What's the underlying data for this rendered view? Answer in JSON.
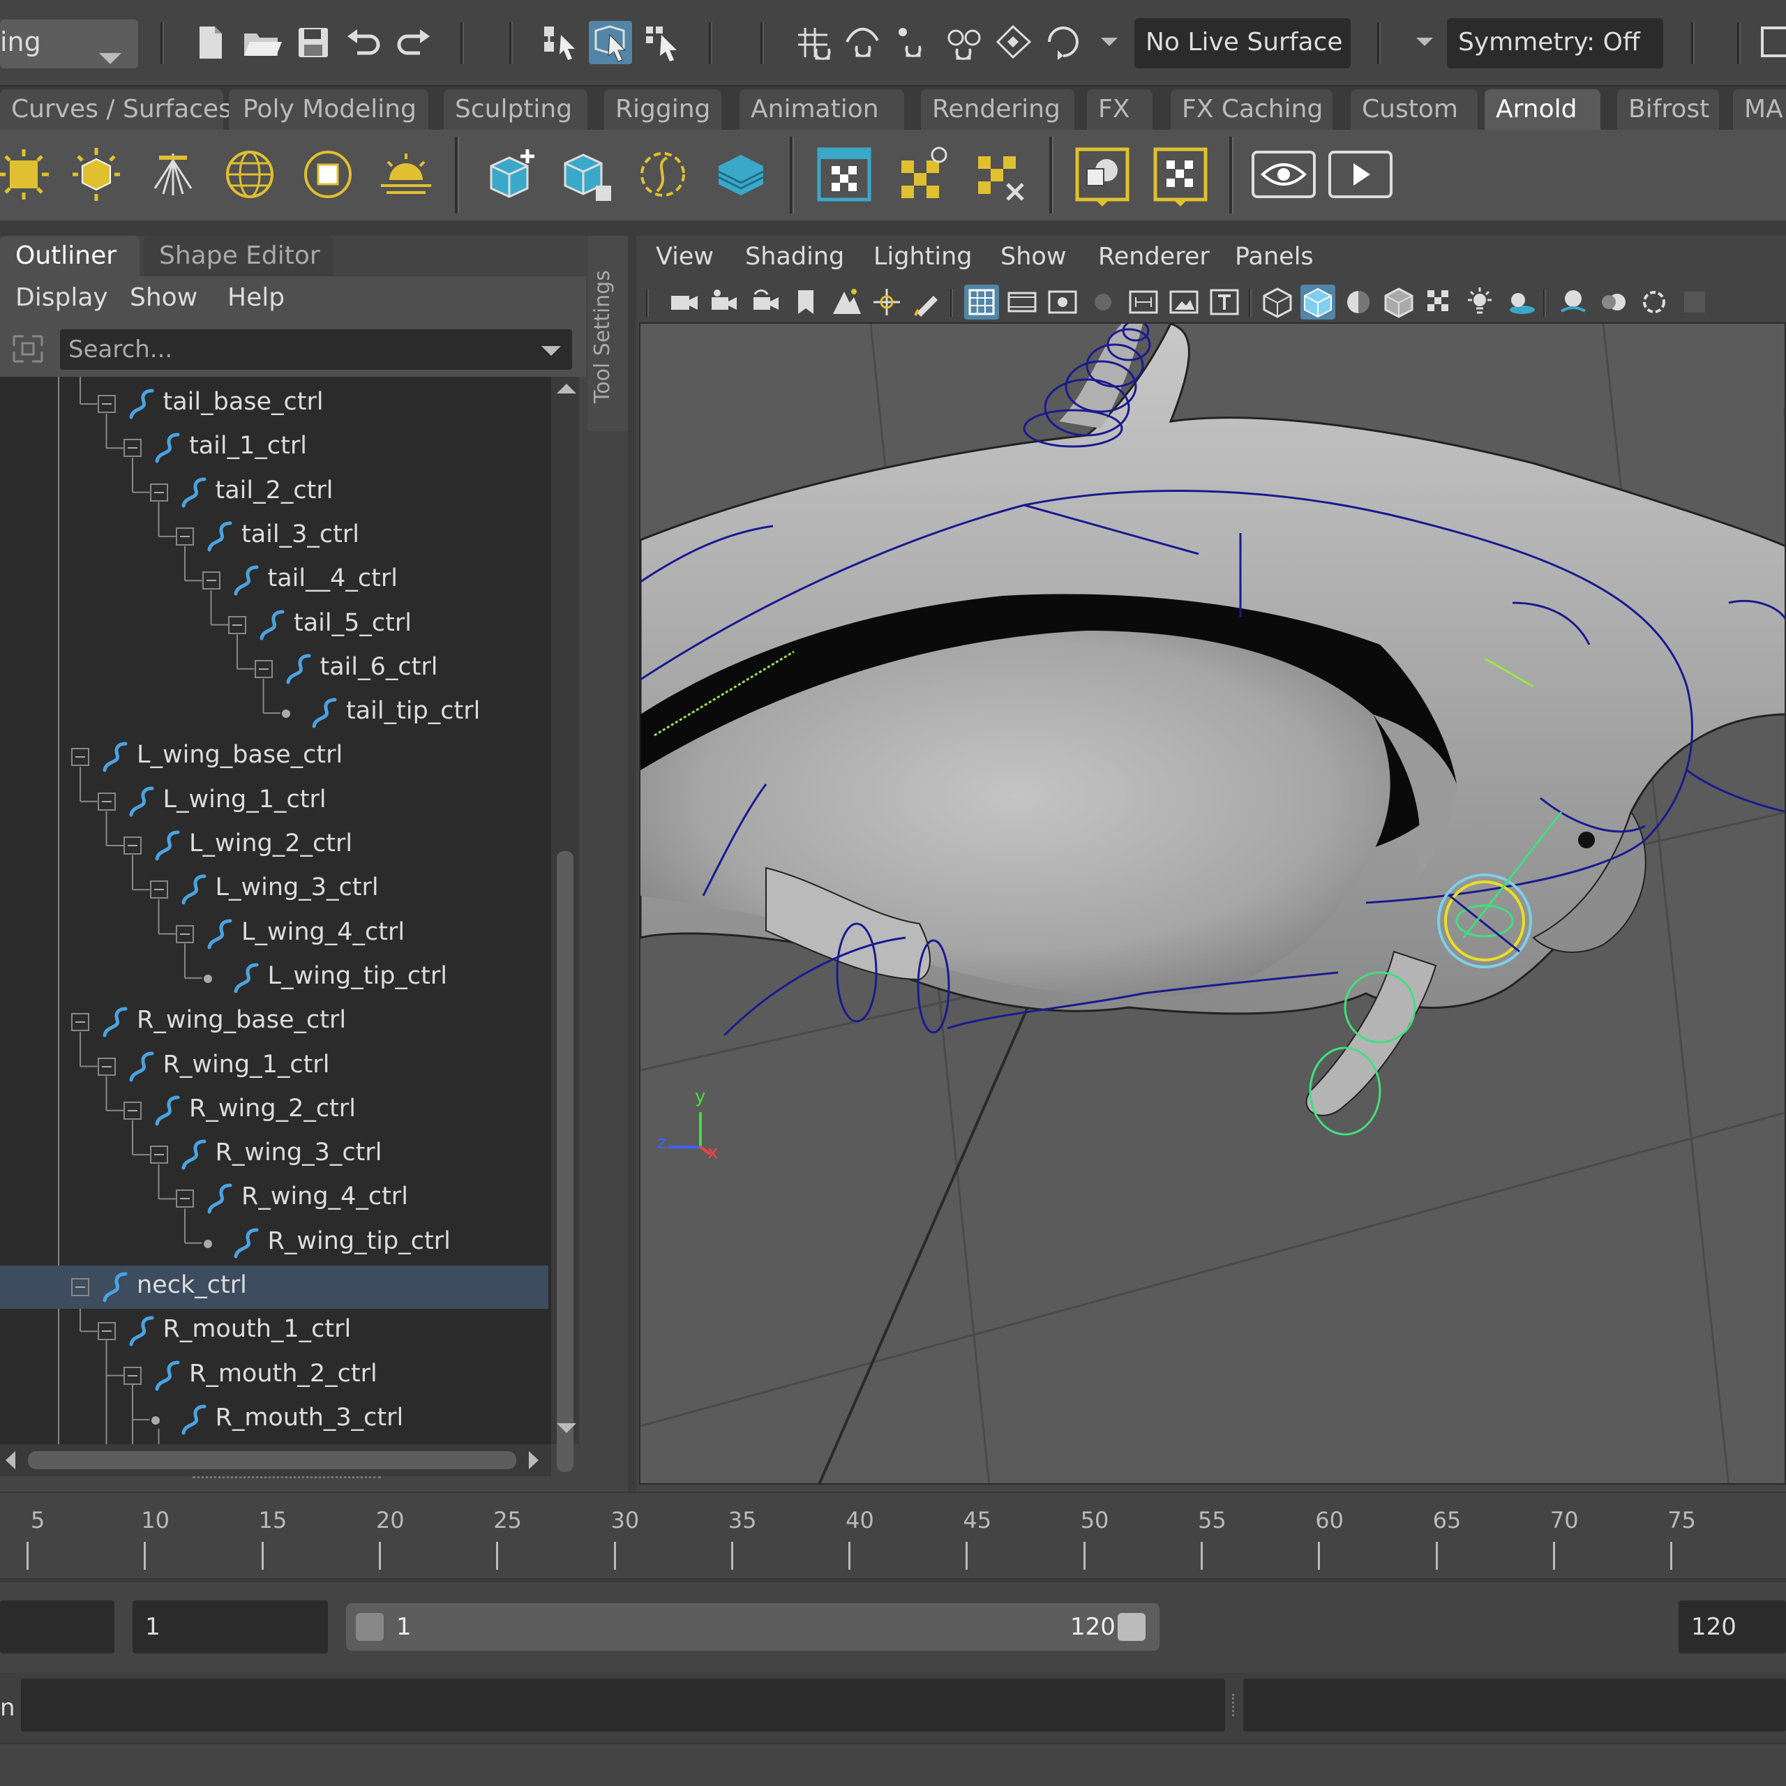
{
  "topbar": {
    "menuset_label": "ing",
    "live_surface": "No Live Surface",
    "symmetry": "Symmetry: Off"
  },
  "shelf_tabs": [
    "Curves / Surfaces",
    "Poly Modeling",
    "Sculpting",
    "Rigging",
    "Animation",
    "Rendering",
    "FX",
    "FX Caching",
    "Custom",
    "Arnold",
    "Bifrost",
    "MA"
  ],
  "shelf_active_tab": "Arnold",
  "outliner": {
    "tabs": [
      "Outliner",
      "Shape Editor"
    ],
    "menu": [
      "Display",
      "Show",
      "Help"
    ],
    "search_placeholder": "Search...",
    "items": [
      {
        "label": "tail_base_ctrl",
        "depth": 1
      },
      {
        "label": "tail_1_ctrl",
        "depth": 2
      },
      {
        "label": "tail_2_ctrl",
        "depth": 3
      },
      {
        "label": "tail_3_ctrl",
        "depth": 4
      },
      {
        "label": "tail__4_ctrl",
        "depth": 5
      },
      {
        "label": "tail_5_ctrl",
        "depth": 6
      },
      {
        "label": "tail_6_ctrl",
        "depth": 7
      },
      {
        "label": "tail_tip_ctrl",
        "depth": 8
      },
      {
        "label": "L_wing_base_ctrl",
        "depth": 0
      },
      {
        "label": "L_wing_1_ctrl",
        "depth": 1
      },
      {
        "label": "L_wing_2_ctrl",
        "depth": 2
      },
      {
        "label": "L_wing_3_ctrl",
        "depth": 3
      },
      {
        "label": "L_wing_4_ctrl",
        "depth": 4
      },
      {
        "label": "L_wing_tip_ctrl",
        "depth": 5
      },
      {
        "label": "R_wing_base_ctrl",
        "depth": 0
      },
      {
        "label": "R_wing_1_ctrl",
        "depth": 1
      },
      {
        "label": "R_wing_2_ctrl",
        "depth": 2
      },
      {
        "label": "R_wing_3_ctrl",
        "depth": 3
      },
      {
        "label": "R_wing_4_ctrl",
        "depth": 4
      },
      {
        "label": "R_wing_tip_ctrl",
        "depth": 5
      },
      {
        "label": "neck_ctrl",
        "depth": 0,
        "selected": true
      },
      {
        "label": "R_mouth_1_ctrl",
        "depth": 1
      },
      {
        "label": "R_mouth_2_ctrl",
        "depth": 2
      },
      {
        "label": "R_mouth_3_ctrl",
        "depth": 3
      }
    ]
  },
  "tool_settings_label": "Tool Settings",
  "viewport": {
    "menu": [
      "View",
      "Shading",
      "Lighting",
      "Show",
      "Renderer",
      "Panels"
    ],
    "axis_labels": {
      "y": "y",
      "z": "z",
      "x": "x"
    }
  },
  "timeline": {
    "ticks": [
      "5",
      "10",
      "15",
      "20",
      "25",
      "30",
      "35",
      "40",
      "45",
      "50",
      "55",
      "60",
      "65",
      "70",
      "75"
    ]
  },
  "range": {
    "start_field": "1",
    "range_start": "1",
    "range_end": "120",
    "end_field": "120"
  },
  "command_line": {
    "language": "n"
  },
  "colors": {
    "accent": "#5285a6",
    "selection": "#3d4c5e",
    "curve_icon": "#4aa3df",
    "shelf_yellow": "#e0c030",
    "shelf_teal": "#3aa8c8",
    "rig_curve": "#1a1a90",
    "rig_green": "#40e080",
    "rig_yellow": "#e8e020"
  }
}
